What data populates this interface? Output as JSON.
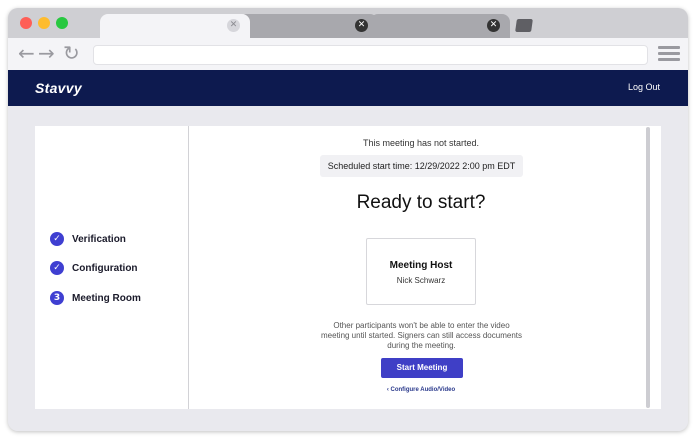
{
  "browser": {
    "tabs": [
      {
        "close_glyph": "✕"
      },
      {
        "close_glyph": "✕"
      },
      {
        "close_glyph": "✕"
      }
    ],
    "nav": {
      "back": "←",
      "forward": "→",
      "reload": "↻"
    },
    "url": ""
  },
  "app": {
    "brand": "Stavvy",
    "logout_label": "Log Out",
    "colors": {
      "header": "#0d1a4f",
      "accent": "#3f3fc6"
    }
  },
  "sidebar": {
    "steps": [
      {
        "icon": "check-icon",
        "glyph": "✓",
        "label": "Verification"
      },
      {
        "icon": "check-icon",
        "glyph": "✓",
        "label": "Configuration"
      },
      {
        "icon": "step-number",
        "glyph": "3",
        "label": "Meeting Room"
      }
    ]
  },
  "main": {
    "notice": "This meeting has not started.",
    "schedule": "Scheduled start time: 12/29/2022 2:00 pm EDT",
    "headline": "Ready to start?",
    "host": {
      "title": "Meeting Host",
      "name": "Nick Schwarz"
    },
    "info": "Other participants won't be able to enter the video meeting until started. Signers can still access documents during the meeting.",
    "start_button": "Start Meeting",
    "config_link": "‹  Configure Audio/Video"
  }
}
